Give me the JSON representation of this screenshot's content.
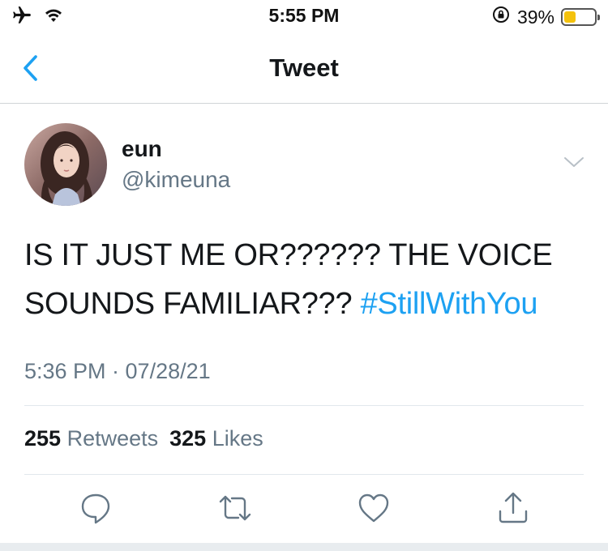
{
  "status_bar": {
    "time": "5:55 PM",
    "battery_percent": "39%",
    "battery_level": 0.39,
    "battery_color": "#f4c20d",
    "icons": [
      "airplane-icon",
      "wifi-icon",
      "rotation-lock-icon",
      "battery-icon"
    ]
  },
  "nav": {
    "title": "Tweet",
    "back_icon": "chevron-left-icon",
    "accent": "#1da1f2"
  },
  "tweet": {
    "display_name": "eun",
    "handle": "@kimeuna",
    "text_line1": "IS IT JUST ME OR?????? THE VOICE",
    "text_line2": "SOUNDS FAMILIAR???",
    "hashtag": "#StillWithYou",
    "timestamp": "5:36 PM · 07/28/21",
    "retweets_count": "255",
    "retweets_label": "Retweets",
    "likes_count": "325",
    "likes_label": "Likes"
  },
  "actions": [
    "reply-icon",
    "retweet-icon",
    "like-icon",
    "share-icon"
  ]
}
